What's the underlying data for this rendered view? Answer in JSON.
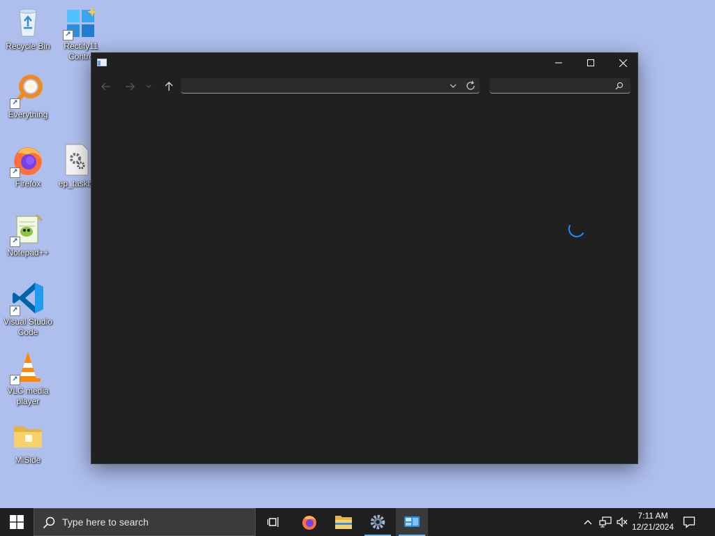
{
  "desktop": {
    "icons": [
      {
        "label": "Recycle Bin"
      },
      {
        "label": "Rectify11 Contro"
      },
      {
        "label": "Everything"
      },
      {
        "label": "Firefox"
      },
      {
        "label": "ep_taskb"
      },
      {
        "label": "Notepad++"
      },
      {
        "label": "Visual Studio Code"
      },
      {
        "label": "VLC media player"
      },
      {
        "label": "MiSide"
      }
    ]
  },
  "window": {
    "address_value": "",
    "search_value": "",
    "controls": [
      "minimize",
      "maximize",
      "close"
    ]
  },
  "taskbar": {
    "search_placeholder": "Type here to search",
    "apps": [
      "task-view",
      "firefox",
      "file-explorer",
      "settings",
      "control-panel"
    ],
    "clock": {
      "time": "7:11 AM",
      "date": "12/21/2024"
    }
  },
  "colors": {
    "wallpaper": "#aebfee",
    "window_bg": "#202020",
    "taskbar_bg": "#1f1f1f",
    "accent": "#1f8fff"
  }
}
